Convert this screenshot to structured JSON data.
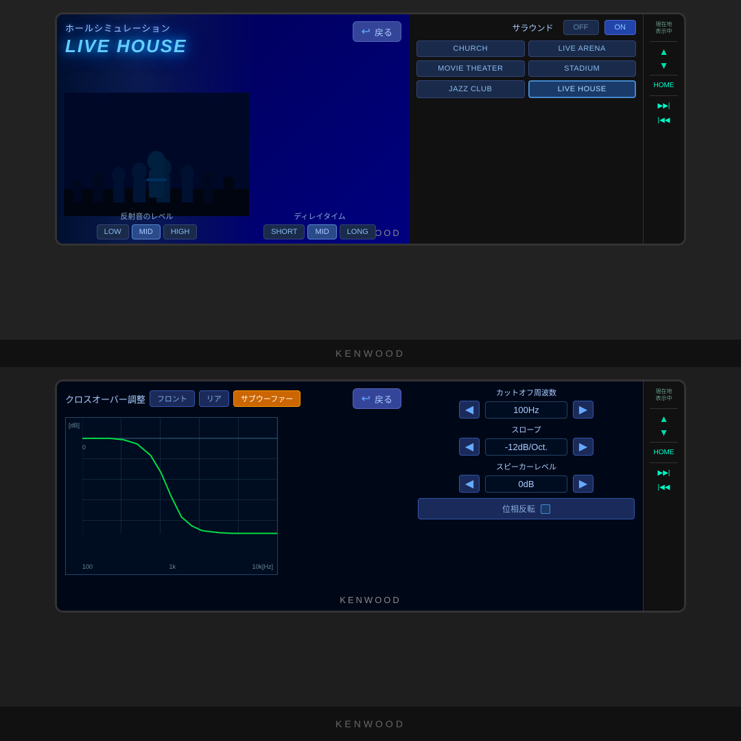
{
  "brand": "KENWOOD",
  "topUnit": {
    "title": "ホールシミュレーション",
    "subtitle": "LIVE HOUSE",
    "backBtn": "戻る",
    "surroundLabel": "サラウンド",
    "offLabel": "OFF",
    "onLabel": "ON",
    "venues": [
      {
        "id": "church",
        "label": "CHURCH",
        "active": false
      },
      {
        "id": "live-arena",
        "label": "LIVE ARENA",
        "active": false
      },
      {
        "id": "movie-theater",
        "label": "MOVIE THEATER",
        "active": false
      },
      {
        "id": "stadium",
        "label": "STADIUM",
        "active": false
      },
      {
        "id": "jazz-club",
        "label": "JAZZ CLUB",
        "active": false
      },
      {
        "id": "live-house",
        "label": "LIVE HOUSE",
        "active": true
      }
    ],
    "reflectionLabel": "反射音のレベル",
    "reflectionLevels": [
      {
        "id": "low",
        "label": "LOW",
        "active": false
      },
      {
        "id": "mid-r",
        "label": "MID",
        "active": true
      },
      {
        "id": "high",
        "label": "HIGH",
        "active": false
      }
    ],
    "delayLabel": "ディレイタイム",
    "delayLevels": [
      {
        "id": "short",
        "label": "SHORT",
        "active": false
      },
      {
        "id": "mid-d",
        "label": "MID",
        "active": true
      },
      {
        "id": "long",
        "label": "LONG",
        "active": false
      }
    ],
    "sideItems": [
      {
        "id": "current-loc",
        "label": "現在地",
        "sub": "表示中"
      },
      {
        "id": "up-arrow",
        "label": "▲"
      },
      {
        "id": "down-arrow",
        "label": "▼"
      },
      {
        "id": "home",
        "label": "HOME"
      },
      {
        "id": "fwd",
        "label": "▶▶|"
      },
      {
        "id": "rwd",
        "label": "|◀◀"
      }
    ]
  },
  "bottomUnit": {
    "title": "クロスオーバー調整",
    "backBtn": "戻る",
    "tabs": [
      {
        "id": "front",
        "label": "フロント",
        "active": false
      },
      {
        "id": "rear",
        "label": "リア",
        "active": false
      },
      {
        "id": "subwoofer",
        "label": "サブウーファー",
        "active": true
      }
    ],
    "cutoffLabel": "カットオフ周波数",
    "cutoffValue": "100Hz",
    "slopeLabel": "スロープ",
    "slopeValue": "-12dB/Oct.",
    "speakerLevelLabel": "スピーカーレベル",
    "speakerLevelValue": "0dB",
    "phaseLabel": "位相反転",
    "graphLabels": {
      "yAxis": "[dB]",
      "zero": "0",
      "x100": "100",
      "x1k": "1k",
      "x10k": "10k[Hz]"
    },
    "sideItems": [
      {
        "id": "current-loc2",
        "label": "現在地",
        "sub": "表示中"
      },
      {
        "id": "up-arrow2",
        "label": "▲"
      },
      {
        "id": "down-arrow2",
        "label": "▼"
      },
      {
        "id": "home2",
        "label": "HOME"
      },
      {
        "id": "fwd2",
        "label": "▶▶|"
      },
      {
        "id": "rwd2",
        "label": "|◀◀"
      }
    ]
  }
}
